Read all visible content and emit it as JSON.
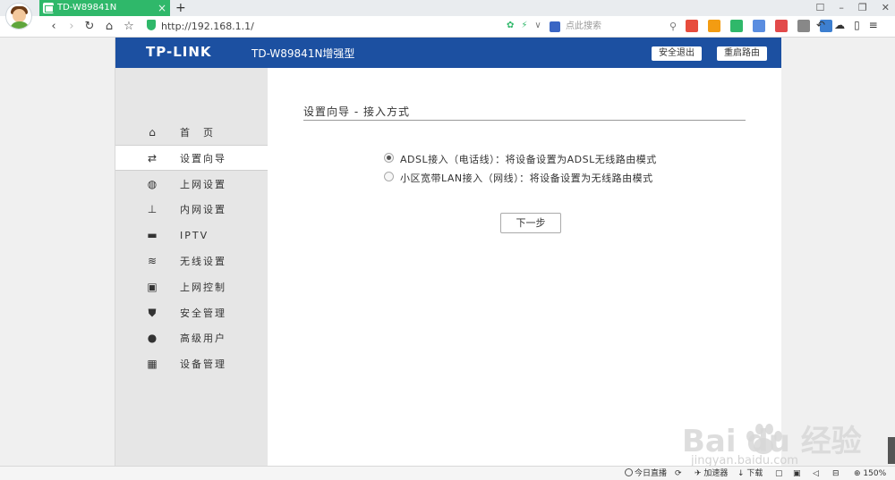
{
  "browser": {
    "tab_title": "TD-W89841N",
    "tab_close": "×",
    "new_tab": "+",
    "window_controls": [
      "☐",
      "–",
      "❐",
      "✕"
    ],
    "nav": {
      "back": "‹",
      "forward": "›",
      "reload": "↻",
      "home": "⌂",
      "star": "☆"
    },
    "url": "http://192.168.1.1/",
    "url_right_icons": [
      "✿",
      "⚡",
      "∨"
    ],
    "search_placeholder": "点此搜索",
    "search_glyph": "⚲",
    "toolbar_icon_colors": [
      "#e74c3c",
      "#f39c12",
      "#2fb86a",
      "#5a8de0",
      "#e24a4a",
      "#888888",
      "#3d7fd0"
    ],
    "right_icons": [
      "↶",
      "☁",
      "▯",
      "≡"
    ]
  },
  "router": {
    "logo": "TP-LINK",
    "model": "TD-W89841N增强型",
    "logout_button": "安全退出",
    "reboot_button": "重启路由",
    "menu": [
      {
        "label": "首　页",
        "icon": "home-icon",
        "glyph": "⌂",
        "active": false
      },
      {
        "label": "设置向导",
        "icon": "exchange-arrows-icon",
        "glyph": "⇄",
        "active": true
      },
      {
        "label": "上网设置",
        "icon": "globe-icon",
        "glyph": "◍",
        "active": false
      },
      {
        "label": "内网设置",
        "icon": "network-icon",
        "glyph": "⊥",
        "active": false
      },
      {
        "label": "IPTV",
        "icon": "tv-icon",
        "glyph": "▬",
        "active": false
      },
      {
        "label": "无线设置",
        "icon": "wifi-icon",
        "glyph": "≋",
        "active": false
      },
      {
        "label": "上网控制",
        "icon": "lock-icon",
        "glyph": "▣",
        "active": false
      },
      {
        "label": "安全管理",
        "icon": "shield-icon",
        "glyph": "⛊",
        "active": false
      },
      {
        "label": "高级用户",
        "icon": "user-icon",
        "glyph": "●",
        "active": false
      },
      {
        "label": "设备管理",
        "icon": "grid-icon",
        "glyph": "▦",
        "active": false
      }
    ],
    "wizard": {
      "title": "设置向导 - 接入方式",
      "options": [
        {
          "label": "ADSL接入（电话线）：将设备设置为ADSL无线路由模式",
          "checked": true
        },
        {
          "label": "小区宽带LAN接入（网线）：将设备设置为无线路由模式",
          "checked": false
        }
      ],
      "next_button": "下一步"
    }
  },
  "watermark": {
    "brand": "Bai du 经验",
    "url": "jingyan.baidu.com"
  },
  "statusbar": {
    "live": "今日直播",
    "accelerator": "加速器",
    "download": "下载",
    "zoom": "150%"
  },
  "colors": {
    "header_blue": "#1c50a1",
    "tab_green": "#2fb86a",
    "sidebar_bg": "#e6e6e6"
  }
}
